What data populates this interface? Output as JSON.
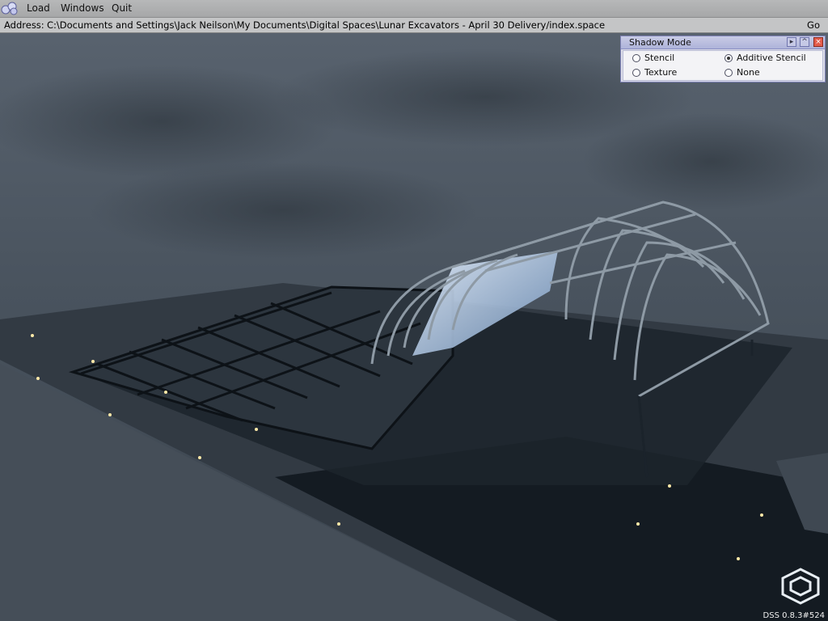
{
  "menu": {
    "items": [
      "Load",
      "Windows",
      "Quit"
    ]
  },
  "address": {
    "label": "Address:",
    "value": "C:\\Documents and Settings\\Jack Neilson\\My Documents\\Digital Spaces\\Lunar Excavators - April 30 Delivery/index.space",
    "go_label": "Go"
  },
  "shadow_panel": {
    "title": "Shadow Mode",
    "options": [
      {
        "label": "Stencil",
        "selected": false
      },
      {
        "label": "Additive Stencil",
        "selected": true
      },
      {
        "label": "Texture",
        "selected": false
      },
      {
        "label": "None",
        "selected": false
      }
    ],
    "icons": [
      "arrow-right-icon",
      "minimize-icon",
      "close-icon"
    ]
  },
  "version": "DSS 0.8.3#524",
  "colors": {
    "terrain": "#3d4650",
    "panel_title": "#aeb3d9",
    "close_button": "#e35b4a"
  }
}
